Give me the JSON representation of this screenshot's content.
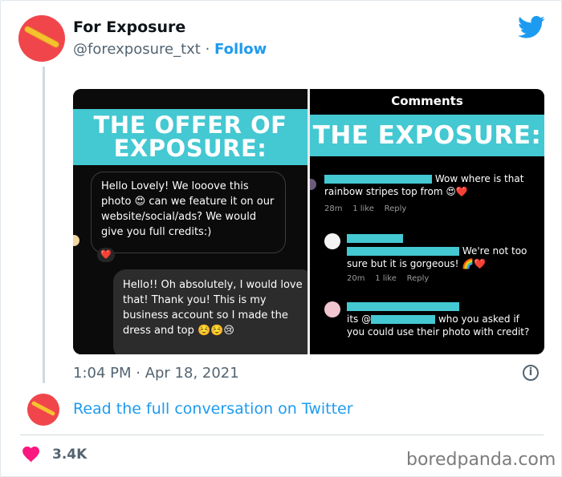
{
  "author": {
    "name": "For Exposure",
    "handle": "@forexposure_txt",
    "separator": " · ",
    "follow_label": "Follow"
  },
  "media": {
    "left_panel": {
      "banner": "THE OFFER OF EXPOSURE:",
      "offer_message": "Hello Lovely! We looove this photo 😍 can we feature it on our website/social/ads? We would give you full credits:)",
      "reply_message": "Hello!! Oh absolutely, I would love that! Thank you! This is my business account so I made the dress and top ☺️☺️😢",
      "reaction": "❤️"
    },
    "right_panel": {
      "header": "Comments",
      "banner": "THE EXPOSURE:",
      "comments": [
        {
          "text": "Wow where is that rainbow stripes top from 😍❤️",
          "time": "28m",
          "likes": "1 like",
          "reply": "Reply"
        },
        {
          "text": "We're not too sure but it is gorgeous! 🌈❤️",
          "time": "20m",
          "likes": "1 like",
          "reply": "Reply"
        },
        {
          "text": "who you asked if you could use their photo with credit?",
          "prefix": "its @",
          "time": "",
          "likes": "",
          "reply": ""
        }
      ]
    }
  },
  "timestamp": "1:04 PM · Apr 18, 2021",
  "read_link": "Read the full conversation on Twitter",
  "likes": "3.4K",
  "watermark": "boredpanda.com",
  "colors": {
    "accent": "#1d9bf0",
    "banner": "#44c8d2",
    "like": "#f91880",
    "avatar": "#f0464b"
  },
  "icons": [
    "twitter-bird-icon",
    "info-icon",
    "heart-icon"
  ]
}
